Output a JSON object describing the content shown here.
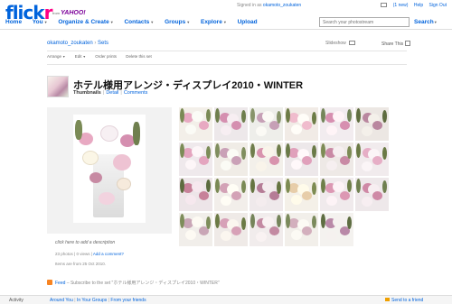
{
  "header": {
    "logo_part1": "flick",
    "logo_part2": "r",
    "from_text": "from",
    "yahoo_text": "YAHOO!",
    "signed_in_prefix": "Signed in as",
    "username": "okamoto_zoukaten",
    "mail_count": "(1 new)",
    "help": "Help",
    "sign_out": "Sign Out",
    "nav": [
      "Home",
      "You",
      "Organize & Create",
      "Contacts",
      "Groups",
      "Explore",
      "Upload"
    ],
    "search_placeholder": "Search your photostream",
    "search_label": "Search"
  },
  "breadcrumb": {
    "user": "okamoto_zoukaten",
    "separator": "›",
    "sets": "Sets",
    "slideshow": "Slideshow",
    "share": "Share This"
  },
  "toolbar": {
    "arrange": "Arrange",
    "edit": "Edit",
    "order_prints": "Order prints",
    "delete_set": "Delete this set"
  },
  "set": {
    "title": "ホテル様用アレンジ・ディスプレイ2010・WINTER",
    "tab_thumbnails": "Thumbnails",
    "tab_detail": "Detail",
    "tab_comments": "Comments",
    "description_placeholder": "click here to add a description",
    "photos_count": "23 photos",
    "views": "0 views",
    "add_comment": "Add a comment?",
    "dates": "Items are from 25 Oct 2010."
  },
  "feed": {
    "link": "Feed",
    "text": "– Subscribe to the set \"ホテル様用アレンジ・ディスプレイ2010・WINTER\""
  },
  "footer": {
    "activity": "Activity",
    "around_you": "Around You",
    "in_your_groups": "In Your Groups",
    "from_your_friends": "From your friends",
    "send_to_friend": "Send to a friend"
  },
  "colors": {
    "flickr_blue": "#0063dc",
    "flickr_pink": "#ff0084",
    "rss_orange": "#f78422"
  },
  "thumbnails": [
    {
      "bg": "#f3efe9",
      "a": "#e8a9c2",
      "b": "#fbfbf6",
      "c": "#7a8a55"
    },
    {
      "bg": "#ede8ea",
      "a": "#d58fb0",
      "b": "#f7eef2",
      "c": "#6f7f4e"
    },
    {
      "bg": "#eeeeea",
      "a": "#c6a0b6",
      "b": "#fbfaf5",
      "c": "#87946a"
    },
    {
      "bg": "#f1ebe6",
      "a": "#f0bccd",
      "b": "#fffdf8",
      "c": "#6d7c47"
    },
    {
      "bg": "#f2ecef",
      "a": "#d78fb0",
      "b": "#fff4f7",
      "c": "#74855a"
    },
    {
      "bg": "#ece7e3",
      "a": "#b9879f",
      "b": "#f4f0ea",
      "c": "#5f6d40"
    },
    {
      "bg": "#efe9ec",
      "a": "#e4a5bf",
      "b": "#fdf6f8",
      "c": "#7c8c57"
    },
    {
      "bg": "#f0ece6",
      "a": "#caa1b7",
      "b": "#fbfbf5",
      "c": "#808e5f"
    },
    {
      "bg": "#f3f0ea",
      "a": "#d893ad",
      "b": "#f9f4ea",
      "c": "#6f7d4b"
    },
    {
      "bg": "#ede8ea",
      "a": "#e0a0bb",
      "b": "#fff8fa",
      "c": "#6a7a48"
    },
    {
      "bg": "#eee9e6",
      "a": "#c98aa5",
      "b": "#f6eff0",
      "c": "#7d8b55"
    },
    {
      "bg": "#f1ebed",
      "a": "#e6aec6",
      "b": "#fbf5f7",
      "c": "#6b7a45"
    },
    {
      "bg": "#ede5e8",
      "a": "#c78199",
      "b": "#f6e8ee",
      "c": "#5c6b3e"
    },
    {
      "bg": "#f2eeea",
      "a": "#d3a2b6",
      "b": "#fffdf5",
      "c": "#7b8a56"
    },
    {
      "bg": "#efe9eb",
      "a": "#b57c96",
      "b": "#f4ecee",
      "c": "#667541"
    },
    {
      "bg": "#f4f0e8",
      "a": "#e7cda9",
      "b": "#fffbea",
      "c": "#7d8b52"
    },
    {
      "bg": "#f0eaec",
      "a": "#dc98b3",
      "b": "#fdf3f6",
      "c": "#6f7f4a"
    },
    {
      "bg": "#eee8ea",
      "a": "#cf89a6",
      "b": "#f7eef1",
      "c": "#708050"
    },
    {
      "bg": "#f1eeea",
      "a": "#c9a6b6",
      "b": "#fdfaf3",
      "c": "#7e8d5b"
    },
    {
      "bg": "#efeae7",
      "a": "#d7a1b7",
      "b": "#fbf6ef",
      "c": "#6c7b46"
    },
    {
      "bg": "#f1ecec",
      "a": "#c38aa2",
      "b": "#f9f2f2",
      "c": "#75845a"
    },
    {
      "bg": "#f2efea",
      "a": "#d3afbd",
      "b": "#fcfaf4",
      "c": "#7b8a5c"
    },
    {
      "bg": "#f4f2ef",
      "a": "#b989a8",
      "b": "#f5f1ef",
      "c": "#5e6d42"
    }
  ]
}
